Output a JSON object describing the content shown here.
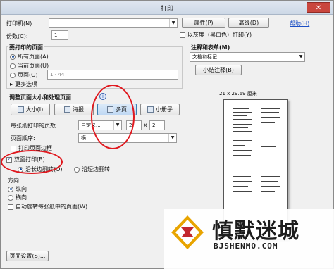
{
  "window": {
    "title": "打印",
    "close_icon": "close-icon"
  },
  "printer": {
    "label": "打印机(N):",
    "value": "",
    "properties": "属性(P)",
    "advanced": "高级(D)",
    "help": "帮助(H)"
  },
  "copies": {
    "label": "份数(C):",
    "value": "1",
    "grayscale": "以灰度（黑白色）打印(Y)"
  },
  "range": {
    "title": "要打印的页面",
    "all": "所有页面(A)",
    "current": "当前页面(U)",
    "pages": "页面(G)",
    "pages_value": "1 - 44",
    "more": "更多选项"
  },
  "comments": {
    "title": "注释和表单(M)",
    "value": "文档和标记",
    "summary": "小结注释(B)"
  },
  "preview": {
    "size": "21 x 29.69 厘米"
  },
  "sizing": {
    "title": "调整页面大小和处理页面",
    "btn_size": "大小(I)",
    "btn_poster": "海报",
    "btn_multi": "多页",
    "btn_booklet": "小册子",
    "pages_per_sheet_label": "每张纸打印的页数:",
    "pages_per_sheet_value": "自定义...",
    "cols": "2",
    "x": "x",
    "rows": "2",
    "order_label": "页面顺序:",
    "order_value": "横",
    "border": "打印页面边框",
    "duplex": "双面打印(B)",
    "long_edge": "沿长边翻转(O)",
    "short_edge": "沿短边翻转"
  },
  "orientation": {
    "title": "方向:",
    "portrait": "纵向",
    "landscape": "横向",
    "auto_rotate": "自动旋转每张纸中的页面(W)"
  },
  "footer": {
    "page_setup": "页面设置(S)..."
  },
  "watermark": {
    "text": "慎默迷城",
    "url": "BJSHENMO.COM"
  },
  "colors": {
    "accent": "#3c7fb1",
    "annotation_red": "#e0181e"
  }
}
